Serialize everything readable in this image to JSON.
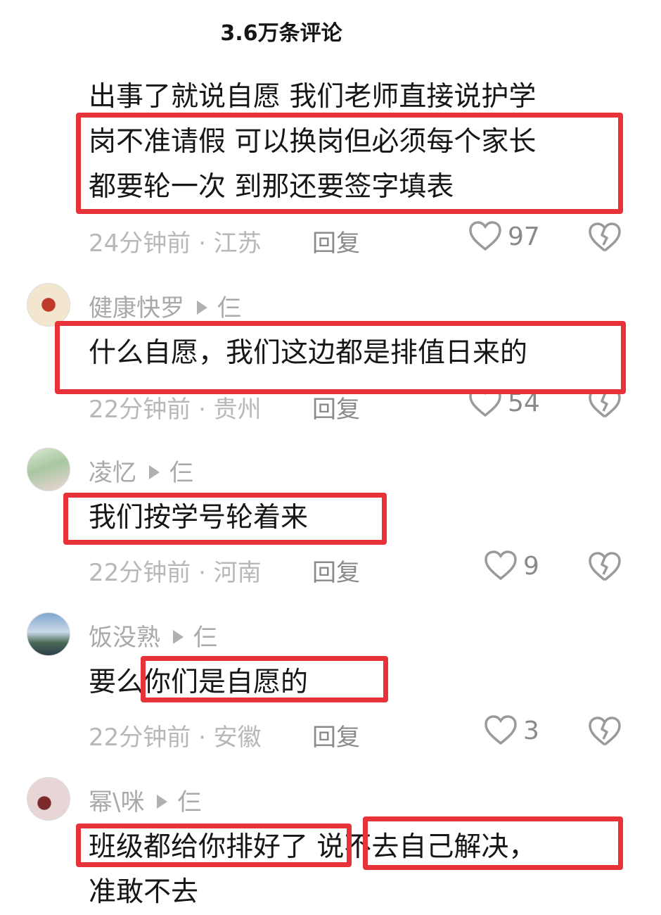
{
  "header": {
    "title": "3.6万条评论"
  },
  "comments": [
    {
      "lines": [
        "出事了就说自愿  我们老师直接说护学",
        "岗不准请假 可以换岗但必须每个家长",
        "都要轮一次 到那还要签字填表"
      ],
      "meta": "24分钟前 · 江苏",
      "reply": "回复",
      "likes": "97"
    },
    {
      "user": "健康快罗",
      "suffix": "仨",
      "lines": [
        "什么自愿，我们这边都是排值日来的"
      ],
      "meta": "22分钟前 · 贵州",
      "reply": "回复",
      "likes": "54"
    },
    {
      "user": "凌忆",
      "suffix": "仨",
      "lines": [
        "我们按学号轮着来"
      ],
      "meta": "22分钟前 · 河南",
      "reply": "回复",
      "likes": "9"
    },
    {
      "user": "饭没熟",
      "suffix": "仨",
      "lines": [
        "要么你们是自愿的"
      ],
      "meta": "22分钟前 · 安徽",
      "reply": "回复",
      "likes": "3"
    },
    {
      "user": "幂\\咪",
      "suffix": "仨",
      "lines": [
        "班级都给你排好了  说不去自己解决，",
        "准敢不去"
      ]
    }
  ],
  "colors": {
    "highlight_box": "#e8323a",
    "text": "#161616",
    "meta": "#b8b8b8"
  }
}
